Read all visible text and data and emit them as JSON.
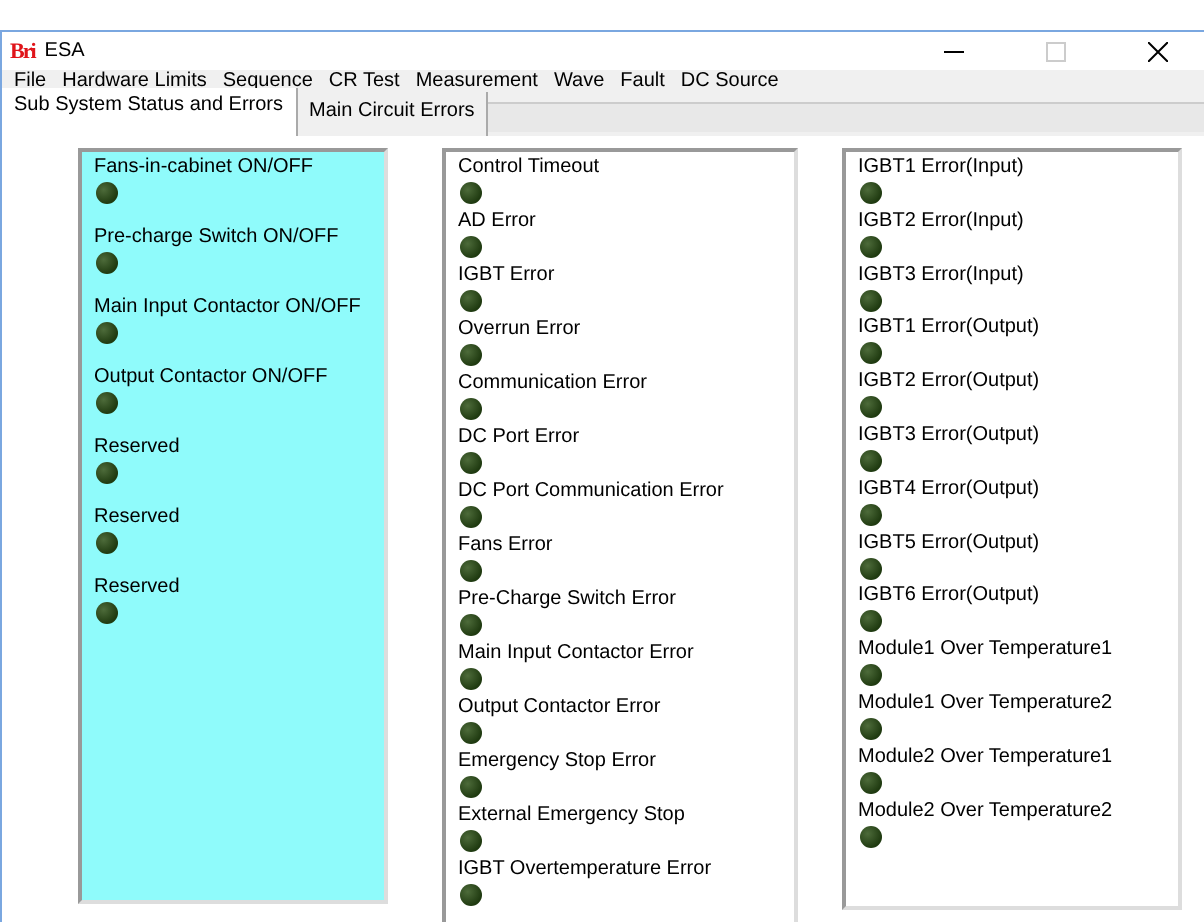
{
  "window": {
    "logo": "Bri",
    "title": "ESA"
  },
  "menu": [
    "File",
    "Hardware Limits",
    "Sequence",
    "CR Test",
    "Measurement",
    "Wave",
    "Fault",
    "DC Source"
  ],
  "tabs": [
    {
      "label": "Sub System Status and Errors",
      "selected": true
    },
    {
      "label": "Main Circuit Errors",
      "selected": false
    }
  ],
  "panels": [
    {
      "highlighted": true,
      "items": [
        {
          "label": "Fans-in-cabinet ON/OFF",
          "on": false
        },
        {
          "label": "Pre-charge Switch ON/OFF",
          "on": false
        },
        {
          "label": "Main Input Contactor ON/OFF",
          "on": false
        },
        {
          "label": "Output Contactor ON/OFF",
          "on": false
        },
        {
          "label": "Reserved",
          "on": false
        },
        {
          "label": "Reserved",
          "on": false
        },
        {
          "label": "Reserved",
          "on": false
        }
      ]
    },
    {
      "highlighted": false,
      "items": [
        {
          "label": "Control Timeout",
          "on": false
        },
        {
          "label": "AD Error",
          "on": false
        },
        {
          "label": "IGBT Error",
          "on": false
        },
        {
          "label": "Overrun Error",
          "on": false
        },
        {
          "label": "Communication Error",
          "on": false
        },
        {
          "label": "DC Port Error",
          "on": false
        },
        {
          "label": "DC Port Communication Error",
          "on": false
        },
        {
          "label": "Fans Error",
          "on": false
        },
        {
          "label": "Pre-Charge Switch Error",
          "on": false
        },
        {
          "label": "Main Input Contactor Error",
          "on": false
        },
        {
          "label": "Output Contactor Error",
          "on": false
        },
        {
          "label": "Emergency Stop Error",
          "on": false
        },
        {
          "label": "External Emergency Stop",
          "on": false
        },
        {
          "label": "IGBT Overtemperature Error",
          "on": false
        }
      ]
    },
    {
      "highlighted": false,
      "items": [
        {
          "label": "IGBT1 Error(Input)",
          "on": false
        },
        {
          "label": "IGBT2 Error(Input)",
          "on": false
        },
        {
          "label": "IGBT3 Error(Input)",
          "on": false
        },
        {
          "label": "IGBT1 Error(Output)",
          "on": false
        },
        {
          "label": "IGBT2 Error(Output)",
          "on": false
        },
        {
          "label": "IGBT3 Error(Output)",
          "on": false
        },
        {
          "label": "IGBT4 Error(Output)",
          "on": false
        },
        {
          "label": "IGBT5 Error(Output)",
          "on": false
        },
        {
          "label": "IGBT6 Error(Output)",
          "on": false
        },
        {
          "label": "Module1 Over Temperature1",
          "on": false
        },
        {
          "label": "Module1 Over Temperature2",
          "on": false
        },
        {
          "label": "Module2 Over Temperature1",
          "on": false
        },
        {
          "label": "Module2 Over Temperature2",
          "on": false
        }
      ]
    }
  ]
}
